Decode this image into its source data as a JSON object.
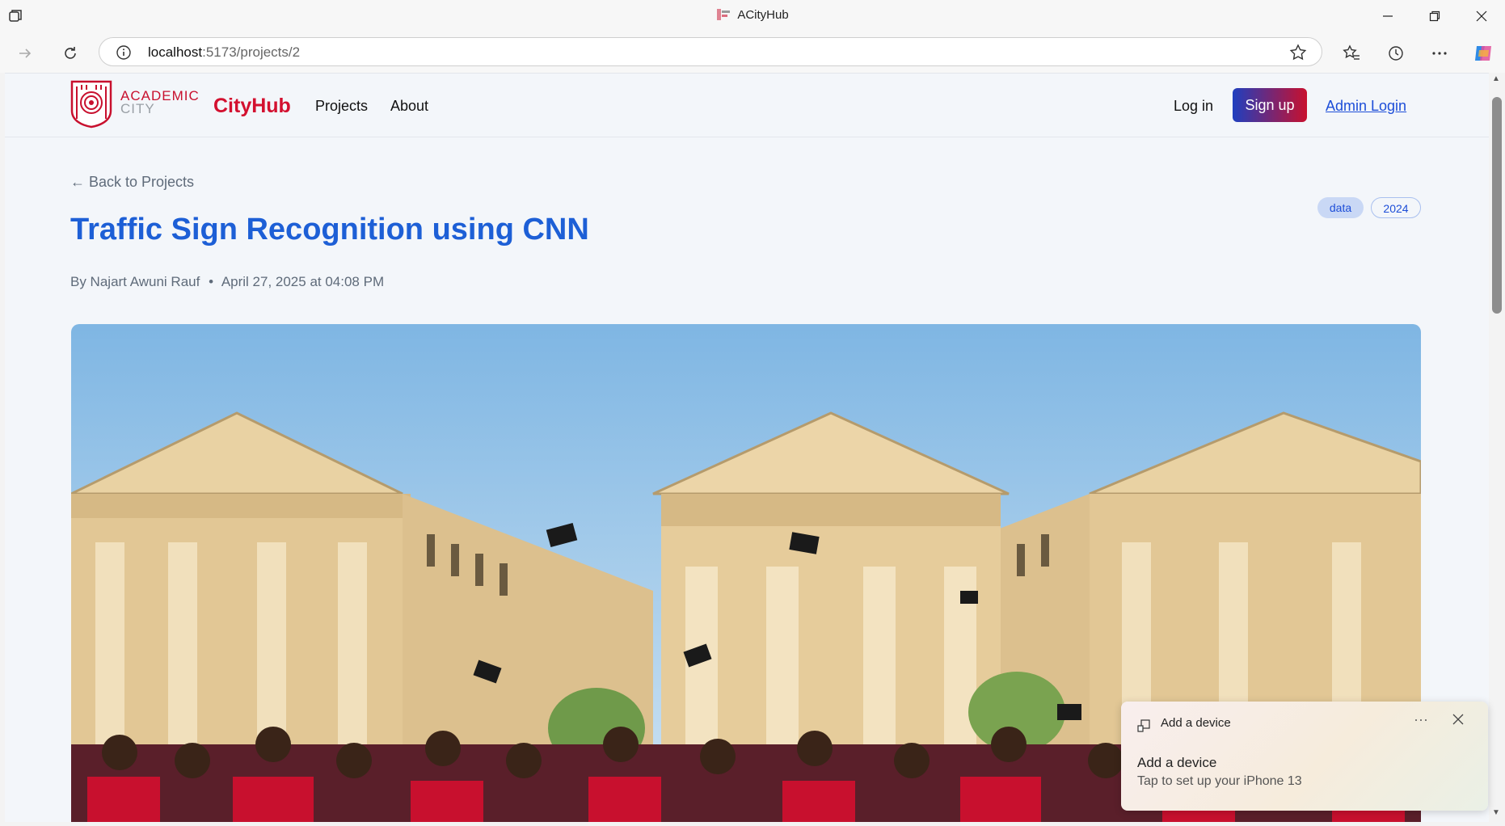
{
  "browser": {
    "window_title": "ACityHub",
    "url_host": "localhost",
    "url_path": ":5173/projects/2"
  },
  "site": {
    "logo_line1": "ACADEMIC",
    "logo_line2": "CITY",
    "brand": "CityHub",
    "nav": [
      "Projects",
      "About"
    ],
    "login_label": "Log in",
    "signup_label": "Sign up",
    "admin_label": "Admin Login"
  },
  "project": {
    "back_label": "← Back to Projects",
    "title": "Traffic Sign Recognition using CNN",
    "author": "By Najart Awuni Rauf",
    "separator": "•",
    "date": "April 27, 2025 at 04:08 PM",
    "tags": [
      "data",
      "2024"
    ]
  },
  "toast": {
    "header": "Add a device",
    "title": "Add a device",
    "subtitle": "Tap to set up your iPhone 13",
    "more": "···"
  },
  "colors": {
    "brand_red": "#d3102f",
    "title_blue": "#1d5fd6",
    "link_blue": "#1d4ed8"
  }
}
